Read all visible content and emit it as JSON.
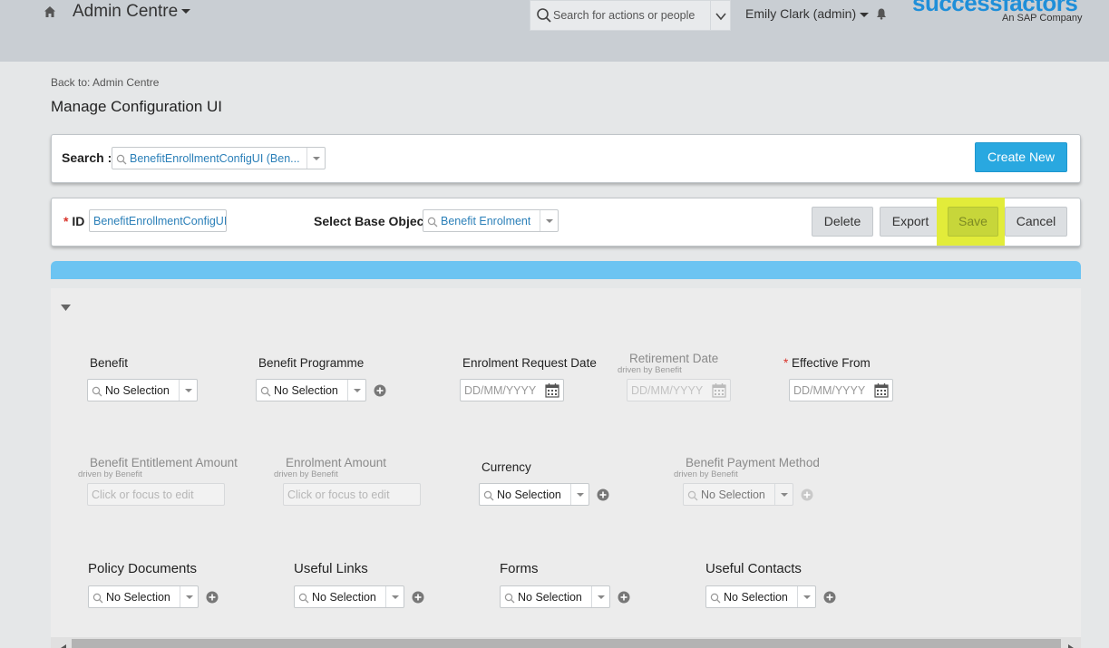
{
  "header": {
    "app_title": "Admin Centre",
    "search_placeholder": "Search for actions or people",
    "user": "Emily Clark (admin)",
    "brand_name": "successfactors",
    "brand_tagline": "An SAP Company"
  },
  "breadcrumb": "Back to: Admin Centre",
  "page_title": "Manage Configuration UI",
  "search_panel": {
    "label": "Search :",
    "value": "BenefitEnrollmentConfigUI (Ben...",
    "create_new": "Create New"
  },
  "id_panel": {
    "required_mark": "*",
    "id_label": "ID",
    "id_value": "BenefitEnrollmentConfigUI",
    "base_object_label": "Select Base Object",
    "base_object_value": "Benefit Enrolment",
    "buttons": {
      "delete": "Delete",
      "export": "Export",
      "save": "Save",
      "cancel": "Cancel"
    }
  },
  "form": {
    "row1": {
      "benefit": {
        "label": "Benefit",
        "value": "No Selection"
      },
      "benefit_programme": {
        "label": "Benefit Programme",
        "value": "No Selection"
      },
      "enrolment_request_date": {
        "label": "Enrolment Request Date",
        "placeholder": "DD/MM/YYYY"
      },
      "retirement_date": {
        "label": "Retirement Date",
        "sub": "driven by Benefit",
        "placeholder": "DD/MM/YYYY"
      },
      "effective_from": {
        "required_mark": "*",
        "label": "Effective From",
        "placeholder": "DD/MM/YYYY"
      }
    },
    "row2": {
      "benefit_entitlement_amount": {
        "label": "Benefit Entitlement Amount",
        "sub": "driven by Benefit",
        "placeholder": "Click or focus to edit"
      },
      "enrolment_amount": {
        "label": "Enrolment Amount",
        "sub": "driven by Benefit",
        "placeholder": "Click or focus to edit"
      },
      "currency": {
        "label": "Currency",
        "value": "No Selection"
      },
      "benefit_payment_method": {
        "label": "Benefit Payment Method",
        "sub": "driven by Benefit",
        "value": "No Selection"
      }
    },
    "row3": {
      "policy_documents": {
        "label": "Policy Documents",
        "value": "No Selection"
      },
      "useful_links": {
        "label": "Useful Links",
        "value": "No Selection"
      },
      "forms": {
        "label": "Forms",
        "value": "No Selection"
      },
      "useful_contacts": {
        "label": "Useful Contacts",
        "value": "No Selection"
      }
    }
  },
  "colors": {
    "primary": "#29a8e0",
    "header_bg": "#c9ced3",
    "highlight": "#e2ec3a",
    "blue_strip": "#6cc4f2",
    "required": "#d9342b"
  }
}
